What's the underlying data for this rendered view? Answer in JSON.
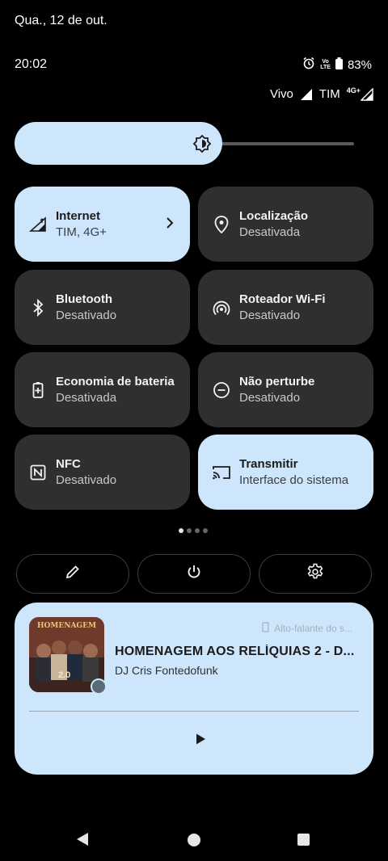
{
  "status": {
    "date": "Qua., 12 de out.",
    "time": "20:02",
    "volte_label": "Vo LTE",
    "battery": "83%",
    "carrier1": "Vivo",
    "carrier2": "TIM",
    "network": "4G+"
  },
  "brightness": {
    "level": 0.6
  },
  "tiles": [
    {
      "label": "Internet",
      "sub": "TIM, 4G+",
      "active": true,
      "icon": "mobile-signal-icon"
    },
    {
      "label": "Localização",
      "sub": "Desativada",
      "active": false,
      "icon": "location-icon"
    },
    {
      "label": "Bluetooth",
      "sub": "Desativado",
      "active": false,
      "icon": "bluetooth-icon"
    },
    {
      "label": "Roteador Wi-Fi",
      "sub": "Desativado",
      "active": false,
      "icon": "hotspot-icon"
    },
    {
      "label": "Economia de bateria",
      "sub": "Desativada",
      "active": false,
      "icon": "battery-saver-icon"
    },
    {
      "label": "Não perturbe",
      "sub": "Desativado",
      "active": false,
      "icon": "do-not-disturb-icon"
    },
    {
      "label": "NFC",
      "sub": "Desativado",
      "active": false,
      "icon": "nfc-icon"
    },
    {
      "label": "Transmitir",
      "sub": "Interface do sistema",
      "active": true,
      "icon": "cast-icon"
    }
  ],
  "pages": {
    "count": 4,
    "current": 1
  },
  "actions": [
    {
      "name": "edit",
      "icon": "pencil-icon"
    },
    {
      "name": "power",
      "icon": "power-icon"
    },
    {
      "name": "settings",
      "icon": "gear-icon"
    }
  ],
  "media": {
    "album_art_text": "HOMENAGEM",
    "album_art_number": "2.0",
    "device": "Alto-falante do s...",
    "title": "HOMENAGEM AOS RELÍQUIAS 2 - D...",
    "artist": "DJ Cris Fontedofunk"
  },
  "colors": {
    "active_tile": "#cde6fb",
    "inactive_tile": "#2f2f2f",
    "background": "#000000"
  }
}
